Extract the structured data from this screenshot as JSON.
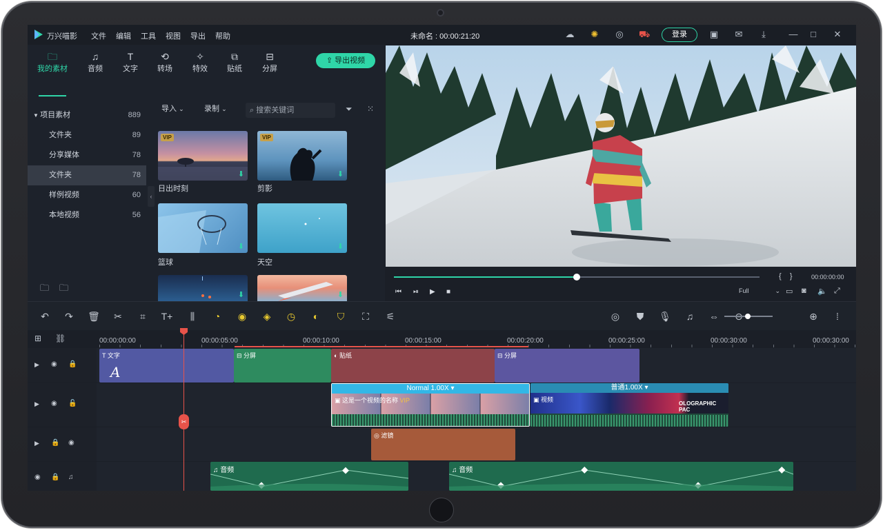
{
  "app": {
    "name": "万兴喵影",
    "title": "未命名 : 00:00:21:20",
    "login": "登录"
  },
  "menu": [
    "文件",
    "编辑",
    "工具",
    "视图",
    "导出",
    "帮助"
  ],
  "tabs": [
    {
      "label": "我的素材",
      "icon": "folder-icon"
    },
    {
      "label": "音频",
      "icon": "music-icon"
    },
    {
      "label": "文字",
      "icon": "text-icon"
    },
    {
      "label": "转场",
      "icon": "transition-icon"
    },
    {
      "label": "特效",
      "icon": "effects-icon"
    },
    {
      "label": "贴纸",
      "icon": "sticker-icon"
    },
    {
      "label": "分屏",
      "icon": "split-screen-icon"
    }
  ],
  "export_label": "导出视频",
  "tree": {
    "root": {
      "label": "项目素材",
      "count": "889"
    },
    "items": [
      {
        "label": "文件夹",
        "count": "89"
      },
      {
        "label": "分享媒体",
        "count": "78"
      },
      {
        "label": "文件夹",
        "count": "78"
      },
      {
        "label": "样例视频",
        "count": "60"
      },
      {
        "label": "本地视频",
        "count": "56"
      }
    ]
  },
  "toolbar": {
    "import": "导入",
    "record": "录制",
    "search_placeholder": "搜索关键词"
  },
  "media": [
    {
      "label": "日出时刻",
      "vip": "VIP"
    },
    {
      "label": "剪影",
      "vip": "VIP"
    },
    {
      "label": "篮球",
      "vip": ""
    },
    {
      "label": "天空",
      "vip": ""
    },
    {
      "label": "",
      "vip": ""
    },
    {
      "label": "",
      "vip": ""
    }
  ],
  "player": {
    "progress": 0.5,
    "brackets": "{    }",
    "time": "00:00:00:00",
    "quality": "Full"
  },
  "ruler": [
    "00:00:00:00",
    "00:00:05:00",
    "00:00:10:00",
    "00:00:15:00",
    "00:00:20:00",
    "00:00:25:00",
    "00:00:30:00",
    "00:00:30:00"
  ],
  "clips": {
    "text": "文字",
    "split1": "分屏",
    "sticker": "贴纸",
    "split2": "分屏",
    "video1_speed": "Normal 1.00X",
    "video1_label": "这是一个视频的名称",
    "video1_badge": "VIP",
    "video2_speed": "普通1.00X",
    "video2_label": "视频",
    "video2_overlay": "OLOGRAPHIC PAC",
    "filter": "滤镜",
    "audio1": "音频",
    "audio2": "音频"
  },
  "colors": {
    "accent": "#2fd6a8",
    "playhead": "#e8534a"
  }
}
